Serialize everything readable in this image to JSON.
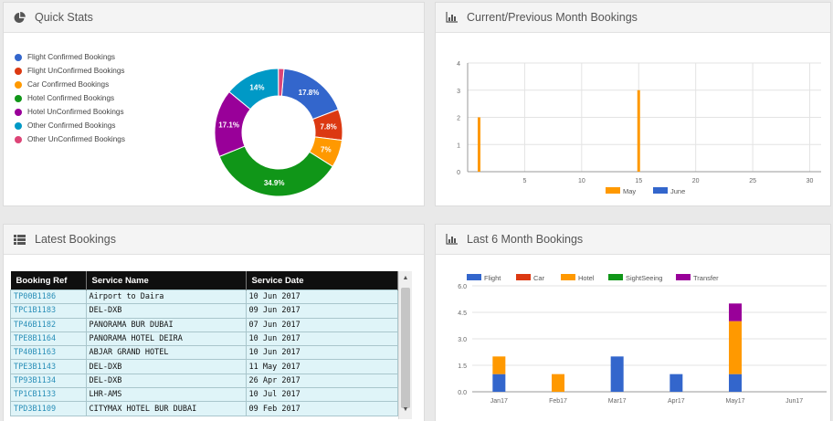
{
  "quick_stats": {
    "title": "Quick Stats",
    "legend": [
      {
        "label": "Flight Confirmed Bookings",
        "color": "#3366cc"
      },
      {
        "label": "Flight UnConfirmed Bookings",
        "color": "#dc3912"
      },
      {
        "label": "Car Confirmed Bookings",
        "color": "#ff9900"
      },
      {
        "label": "Hotel Confirmed Bookings",
        "color": "#109618"
      },
      {
        "label": "Hotel UnConfirmed Bookings",
        "color": "#990099"
      },
      {
        "label": "Other Confirmed Bookings",
        "color": "#0099c6"
      },
      {
        "label": "Other UnConfirmed Bookings",
        "color": "#dd4477"
      }
    ]
  },
  "current_previous": {
    "title": "Current/Previous Month Bookings"
  },
  "latest_bookings": {
    "title": "Latest Bookings",
    "columns": [
      "Booking Ref",
      "Service Name",
      "Service Date"
    ],
    "rows": [
      [
        "TP00B1186",
        "Airport to Daira",
        "10 Jun 2017"
      ],
      [
        "TPC1B1183",
        "DEL-DXB",
        "09 Jun 2017"
      ],
      [
        "TP46B1182",
        "PANORAMA BUR DUBAI",
        "07 Jun 2017"
      ],
      [
        "TPE8B1164",
        "PANORAMA HOTEL DEIRA",
        "10 Jun 2017"
      ],
      [
        "TP40B1163",
        "ABJAR GRAND HOTEL",
        "10 Jun 2017"
      ],
      [
        "TPE3B1143",
        "DEL-DXB",
        "11 May 2017"
      ],
      [
        "TP93B1134",
        "DEL-DXB",
        "26 Apr 2017"
      ],
      [
        "TP1CB1133",
        "LHR-AMS",
        "10 Jul 2017"
      ],
      [
        "TPD3B1109",
        "CITYMAX HOTEL BUR DUBAI",
        "09 Feb 2017"
      ]
    ]
  },
  "last6": {
    "title": "Last 6 Month Bookings"
  },
  "chart_data": [
    {
      "type": "pie",
      "categories": [
        "Flight Confirmed Bookings",
        "Flight UnConfirmed Bookings",
        "Car Confirmed Bookings",
        "Hotel Confirmed Bookings",
        "Hotel UnConfirmed Bookings",
        "Other Confirmed Bookings",
        "Other UnConfirmed Bookings"
      ],
      "values": [
        17.8,
        7.8,
        7,
        34.9,
        17.1,
        14,
        1.4
      ],
      "labels": [
        "17.8%",
        "7.8%",
        "7%",
        "34.9%",
        "17.1%",
        "14%",
        ""
      ],
      "colors": [
        "#3366cc",
        "#dc3912",
        "#ff9900",
        "#109618",
        "#990099",
        "#0099c6",
        "#dd4477"
      ],
      "donut": true
    },
    {
      "type": "bar",
      "x_ticks": [
        5,
        10,
        15,
        20,
        25,
        30
      ],
      "y_ticks": [
        0,
        1,
        2,
        3,
        4
      ],
      "ylim": [
        0,
        4
      ],
      "xlim": [
        0,
        31
      ],
      "series": [
        {
          "name": "May",
          "color": "#ff9900",
          "points": [
            [
              1,
              2
            ],
            [
              15,
              3
            ]
          ]
        },
        {
          "name": "June",
          "color": "#3366cc",
          "points": []
        }
      ],
      "legend": "bottom"
    },
    {
      "type": "bar",
      "stacked": true,
      "categories": [
        "Jan17",
        "Feb17",
        "Mar17",
        "Apr17",
        "May17",
        "Jun17"
      ],
      "y_ticks": [
        "0.0",
        "1.5",
        "3.0",
        "4.5",
        "6.0"
      ],
      "ylim": [
        0,
        6
      ],
      "series": [
        {
          "name": "Flight",
          "color": "#3366cc",
          "values": [
            1,
            0,
            2,
            1,
            1,
            0
          ]
        },
        {
          "name": "Car",
          "color": "#dc3912",
          "values": [
            0,
            0,
            0,
            0,
            0,
            0
          ]
        },
        {
          "name": "Hotel",
          "color": "#ff9900",
          "values": [
            1,
            1,
            0,
            0,
            3,
            0
          ]
        },
        {
          "name": "SightSeeing",
          "color": "#109618",
          "values": [
            0,
            0,
            0,
            0,
            0,
            0
          ]
        },
        {
          "name": "Transfer",
          "color": "#990099",
          "values": [
            0,
            0,
            0,
            0,
            1,
            0
          ]
        }
      ],
      "legend": "top"
    }
  ]
}
